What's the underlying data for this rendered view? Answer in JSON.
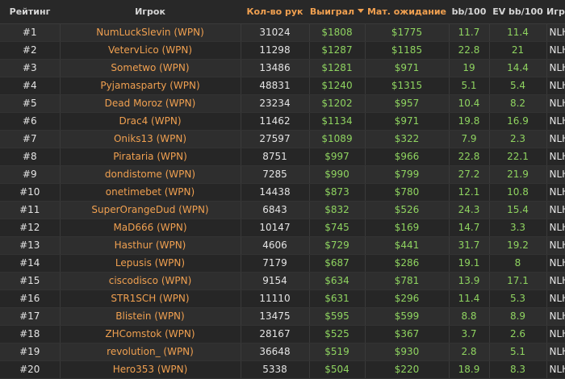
{
  "header": {
    "rank": "Рейтинг",
    "player": "Игрок",
    "hands": "Кол-во рук",
    "won": "Выиграл",
    "ev": "Мат. ожидание",
    "bb100": "bb/100",
    "evbb100": "EV bb/100",
    "game": "Игра"
  },
  "sort": {
    "column": "won",
    "direction": "desc",
    "caret_icon": "caret-down-icon"
  },
  "colors": {
    "accent": "#f0a050",
    "positive": "#8fd460",
    "text": "#e4e4e4",
    "background": "#262626"
  },
  "rows": [
    {
      "rank": "#1",
      "player": "NumLuckSlevin (WPN)",
      "hands": "31024",
      "won": "$1808",
      "ev": "$1775",
      "bb": "11.7",
      "evbb": "11.4",
      "game": "NLHE"
    },
    {
      "rank": "#2",
      "player": "VetervLico (WPN)",
      "hands": "11298",
      "won": "$1287",
      "ev": "$1185",
      "bb": "22.8",
      "evbb": "21",
      "game": "NLHE"
    },
    {
      "rank": "#3",
      "player": "Sometwo (WPN)",
      "hands": "13486",
      "won": "$1281",
      "ev": "$971",
      "bb": "19",
      "evbb": "14.4",
      "game": "NLHE"
    },
    {
      "rank": "#4",
      "player": "Pyjamasparty (WPN)",
      "hands": "48831",
      "won": "$1240",
      "ev": "$1315",
      "bb": "5.1",
      "evbb": "5.4",
      "game": "NLHE"
    },
    {
      "rank": "#5",
      "player": "Dead Moroz (WPN)",
      "hands": "23234",
      "won": "$1202",
      "ev": "$957",
      "bb": "10.4",
      "evbb": "8.2",
      "game": "NLHE"
    },
    {
      "rank": "#6",
      "player": "Drac4 (WPN)",
      "hands": "11462",
      "won": "$1134",
      "ev": "$971",
      "bb": "19.8",
      "evbb": "16.9",
      "game": "NLHE"
    },
    {
      "rank": "#7",
      "player": "Oniks13 (WPN)",
      "hands": "27597",
      "won": "$1089",
      "ev": "$322",
      "bb": "7.9",
      "evbb": "2.3",
      "game": "NLHE"
    },
    {
      "rank": "#8",
      "player": "Pirataria (WPN)",
      "hands": "8751",
      "won": "$997",
      "ev": "$966",
      "bb": "22.8",
      "evbb": "22.1",
      "game": "NLHE"
    },
    {
      "rank": "#9",
      "player": "dondistome (WPN)",
      "hands": "7285",
      "won": "$990",
      "ev": "$799",
      "bb": "27.2",
      "evbb": "21.9",
      "game": "NLHE"
    },
    {
      "rank": "#10",
      "player": "onetimebet (WPN)",
      "hands": "14438",
      "won": "$873",
      "ev": "$780",
      "bb": "12.1",
      "evbb": "10.8",
      "game": "NLHE"
    },
    {
      "rank": "#11",
      "player": "SuperOrangeDud (WPN)",
      "hands": "6843",
      "won": "$832",
      "ev": "$526",
      "bb": "24.3",
      "evbb": "15.4",
      "game": "NLHE"
    },
    {
      "rank": "#12",
      "player": "MaD666 (WPN)",
      "hands": "10147",
      "won": "$745",
      "ev": "$169",
      "bb": "14.7",
      "evbb": "3.3",
      "game": "NLHE"
    },
    {
      "rank": "#13",
      "player": "Hasthur (WPN)",
      "hands": "4606",
      "won": "$729",
      "ev": "$441",
      "bb": "31.7",
      "evbb": "19.2",
      "game": "NLHE"
    },
    {
      "rank": "#14",
      "player": "Lepusis (WPN)",
      "hands": "7179",
      "won": "$687",
      "ev": "$286",
      "bb": "19.1",
      "evbb": "8",
      "game": "NLHE"
    },
    {
      "rank": "#15",
      "player": "ciscodisco (WPN)",
      "hands": "9154",
      "won": "$634",
      "ev": "$781",
      "bb": "13.9",
      "evbb": "17.1",
      "game": "NLHE"
    },
    {
      "rank": "#16",
      "player": "STR1SCH (WPN)",
      "hands": "11110",
      "won": "$631",
      "ev": "$296",
      "bb": "11.4",
      "evbb": "5.3",
      "game": "NLHE"
    },
    {
      "rank": "#17",
      "player": "Blistein (WPN)",
      "hands": "13475",
      "won": "$595",
      "ev": "$599",
      "bb": "8.8",
      "evbb": "8.9",
      "game": "NLHE"
    },
    {
      "rank": "#18",
      "player": "ZHComstok (WPN)",
      "hands": "28167",
      "won": "$525",
      "ev": "$367",
      "bb": "3.7",
      "evbb": "2.6",
      "game": "NLHE"
    },
    {
      "rank": "#19",
      "player": "revolution_ (WPN)",
      "hands": "36648",
      "won": "$519",
      "ev": "$930",
      "bb": "2.8",
      "evbb": "5.1",
      "game": "NLHE"
    },
    {
      "rank": "#20",
      "player": "Hero353 (WPN)",
      "hands": "5338",
      "won": "$504",
      "ev": "$220",
      "bb": "18.9",
      "evbb": "8.3",
      "game": "NLHE"
    }
  ]
}
